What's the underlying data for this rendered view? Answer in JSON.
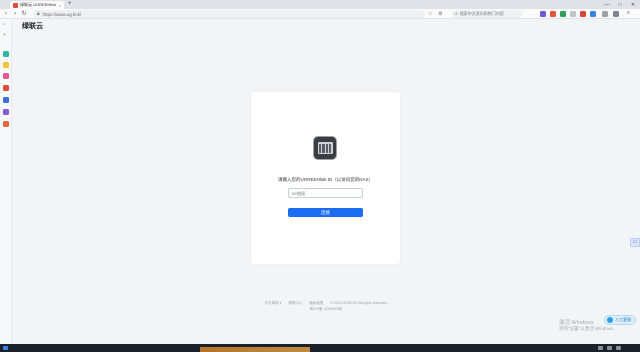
{
  "browser": {
    "tab_title": "绿联云 UGREENlink",
    "tab_close": "×",
    "new_tab": "+",
    "url": "https://www.ug.link/",
    "search_placeholder": "搜索中文资讯和热门内容",
    "window_controls": [
      "—",
      "□",
      "✕"
    ],
    "nav": {
      "back": "‹",
      "forward": "›",
      "reload": "↻"
    }
  },
  "page": {
    "logo_text": "绿联云",
    "prompt": "请输入您的UGREENlink ID（以访问您的NAS）",
    "id_placeholder": "ID/链接",
    "connect_label": "连接",
    "side_float_icon": "chat-icon",
    "footer": {
      "line1": "中文简体 ▾　　帮助中心　　隐私政策　　© 2023 UGREEN All rights reserved.",
      "line2": "粤ICP备 12345678号"
    },
    "help_label": "人工客服"
  },
  "watermark": {
    "line1": "激活 Windows",
    "line2": "转到\"设置\"以激活 Windows。"
  },
  "colors": {
    "accent": "#1a6cf0",
    "favicon": "#e24a3b"
  }
}
